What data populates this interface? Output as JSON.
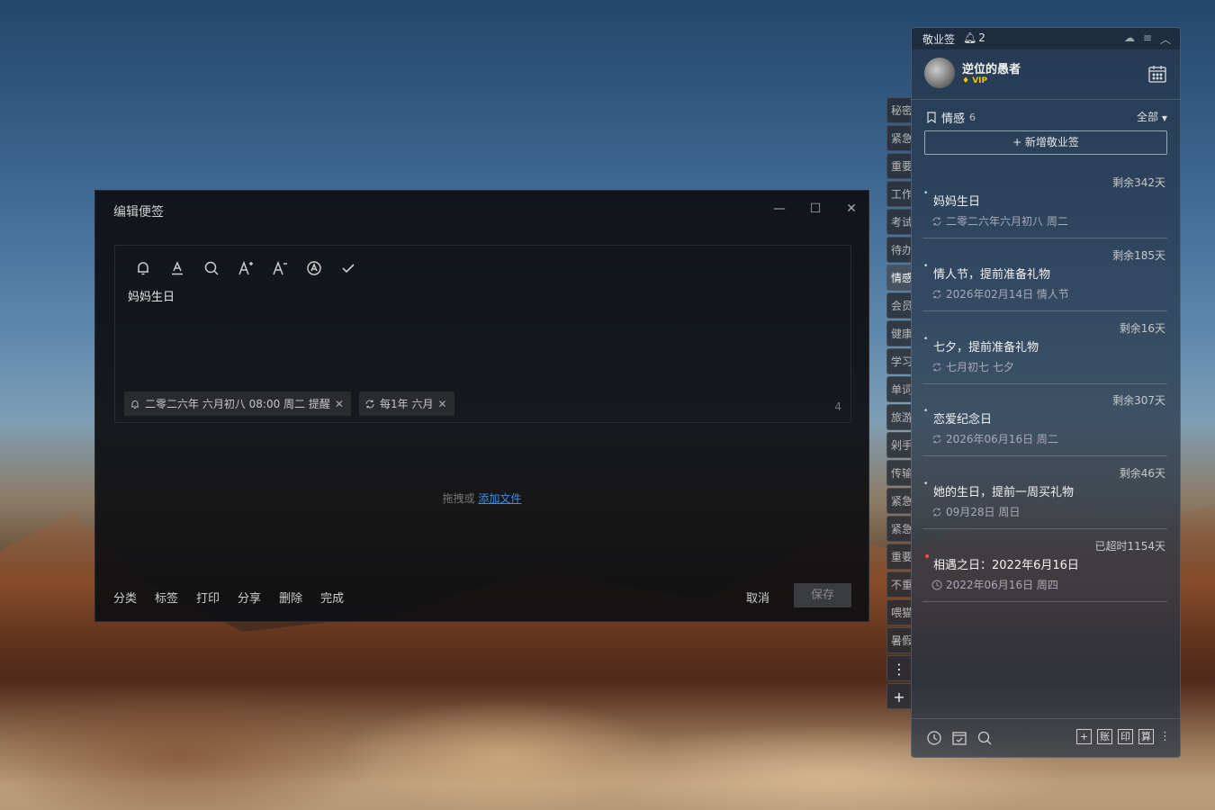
{
  "editor": {
    "title": "编辑便签",
    "content": "妈妈生日",
    "reminder_tag": "二零二六年 六月初八 08:00 周二 提醒",
    "repeat_tag": "每1年 六月",
    "char_count": "4",
    "drop_text": "拖拽或",
    "drop_link": "添加文件",
    "actions": [
      "分类",
      "标签",
      "打印",
      "分享",
      "删除",
      "完成"
    ],
    "cancel": "取消",
    "save": "保存"
  },
  "sidetabs": [
    "秘密",
    "紧急",
    "重要",
    "工作",
    "考试",
    "待办",
    "情感",
    "会员",
    "健康",
    "学习",
    "单词",
    "旅游",
    "剁手",
    "传输",
    "紧急",
    "紧急",
    "重要",
    "不重",
    "喂猫",
    "暑假"
  ],
  "panel": {
    "brand": "敬业签",
    "bell_count": "2",
    "username": "逆位的愚者",
    "vip": "VIP",
    "category": "情感",
    "category_count": "6",
    "filter": "全部",
    "new_button": "+ 新增敬业签",
    "items": [
      {
        "remain": "剩余342天",
        "title": "妈妈生日",
        "sub": "二零二六年六月初八 周二"
      },
      {
        "remain": "剩余185天",
        "title": "情人节，提前准备礼物",
        "sub": "2026年02月14日 情人节"
      },
      {
        "remain": "剩余16天",
        "title": "七夕，提前准备礼物",
        "sub": "七月初七 七夕"
      },
      {
        "remain": "剩余307天",
        "title": "恋爱纪念日",
        "sub": "2026年06月16日 周二"
      },
      {
        "remain": "剩余46天",
        "title": "她的生日，提前一周买礼物",
        "sub": "09月28日 周日"
      },
      {
        "remain": "已超时1154天",
        "title": "相遇之日：2022年6月16日",
        "sub": "2022年06月16日 周四"
      }
    ],
    "bottom_tools": [
      "账",
      "印",
      "算"
    ]
  },
  "colors": {
    "link": "#3b8ee8",
    "overdue": "#ff4747",
    "vip": "#f5c400"
  }
}
